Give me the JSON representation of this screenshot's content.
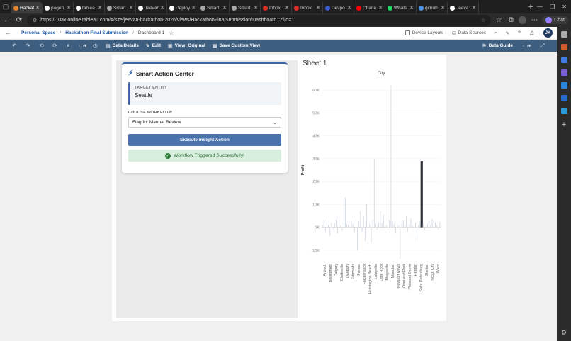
{
  "browser": {
    "tabs": [
      {
        "label": "Hackat",
        "active": true,
        "color": "#e67e22"
      },
      {
        "label": "pagen",
        "color": "#ffffff"
      },
      {
        "label": "tablea",
        "color": "#ffffff"
      },
      {
        "label": "Smart",
        "color": "#aaaaaa"
      },
      {
        "label": "Jeevan",
        "color": "#ffffff"
      },
      {
        "label": "Deploy",
        "color": "#ffffff"
      },
      {
        "label": "Smart",
        "color": "#aaaaaa"
      },
      {
        "label": "Smart",
        "color": "#aaaaaa"
      },
      {
        "label": "Inbox",
        "color": "#d93025"
      },
      {
        "label": "Inbox",
        "color": "#d93025"
      },
      {
        "label": "Devpo",
        "color": "#3b5bdb"
      },
      {
        "label": "Chane",
        "color": "#ff0000"
      },
      {
        "label": "Whats",
        "color": "#25d366"
      },
      {
        "label": "github",
        "color": "#4a90e2"
      },
      {
        "label": "Jeeva",
        "color": "#ffffff"
      }
    ],
    "url": "https://10ax.online.tableau.com/#/site/jeevan-hackathon-2026/views/HackathonFinalSubmission/Dashboard1?:iid=1",
    "chat_label": "Chat"
  },
  "header": {
    "breadcrumb": {
      "space": "Personal Space",
      "workbook": "Hackathon Final Submission",
      "view": "Dashboard 1"
    },
    "device_layouts": "Device Layouts",
    "data_sources": "Data Sources",
    "avatar_initials": "JK"
  },
  "toolbar": {
    "data_details": "Data Details",
    "edit": "Edit",
    "view_original": "View: Original",
    "save_custom_view": "Save Custom View",
    "data_guide": "Data Guide"
  },
  "action_center": {
    "title": "Smart Action Center",
    "entity_label": "TARGET ENTITY",
    "entity_value": "Seattle",
    "workflow_label": "CHOOSE WORKFLOW",
    "workflow_value": "Flag for Manual Review",
    "execute_label": "Execute Insight Action",
    "success_message": "Workflow Triggered Successfully!"
  },
  "sheet": {
    "title": "Sheet 1"
  },
  "chart_data": {
    "type": "bar",
    "title": "City",
    "ylabel": "Profit",
    "ylim": [
      -15000,
      65000
    ],
    "yticks": [
      -10000,
      0,
      10000,
      20000,
      30000,
      40000,
      50000,
      60000
    ],
    "ytick_labels": [
      "-10K",
      "0K",
      "10K",
      "20K",
      "30K",
      "40K",
      "50K",
      "60K"
    ],
    "highlight_city": "Seattle",
    "highlight_value": 29000,
    "highlight_color": "#2b2f36",
    "bar_color": "#c9d3de",
    "visible_labels": [
      "Antioch",
      "Bellingham",
      "Calgary",
      "Clarksville",
      "Danbury",
      "Edmonds",
      "Fresno",
      "Hackensack",
      "Huntington Beach",
      "Lafayette",
      "Little Rock",
      "Marysville",
      "Moncton",
      "Newport News",
      "Overland Park",
      "Pleasant Grove",
      "Renton",
      "Saint Petersburg",
      "Shelton",
      "Texas City",
      "Waco"
    ],
    "values": [
      1200,
      3500,
      -2000,
      4500,
      900,
      -3800,
      2000,
      -900,
      1800,
      3200,
      -2600,
      5000,
      900,
      -1500,
      2200,
      13000,
      1400,
      800,
      -500,
      2600,
      1500,
      -2000,
      4000,
      -10000,
      2800,
      7000,
      -2000,
      5000,
      -6000,
      10000,
      2600,
      1200,
      -7000,
      3100,
      30000,
      1600,
      -1000,
      2200,
      7000,
      1900,
      5500,
      800,
      900,
      -1600,
      3300,
      62000,
      2500,
      1400,
      -2400,
      1900,
      800,
      -14000,
      1300,
      3000,
      1600,
      5200,
      -1800,
      1500,
      4000,
      700,
      -3500,
      2000,
      -7000,
      900,
      2500,
      29000,
      1600,
      -1400,
      800,
      1800,
      2800,
      1100,
      3600,
      900,
      2100,
      800,
      -900,
      2400
    ]
  }
}
